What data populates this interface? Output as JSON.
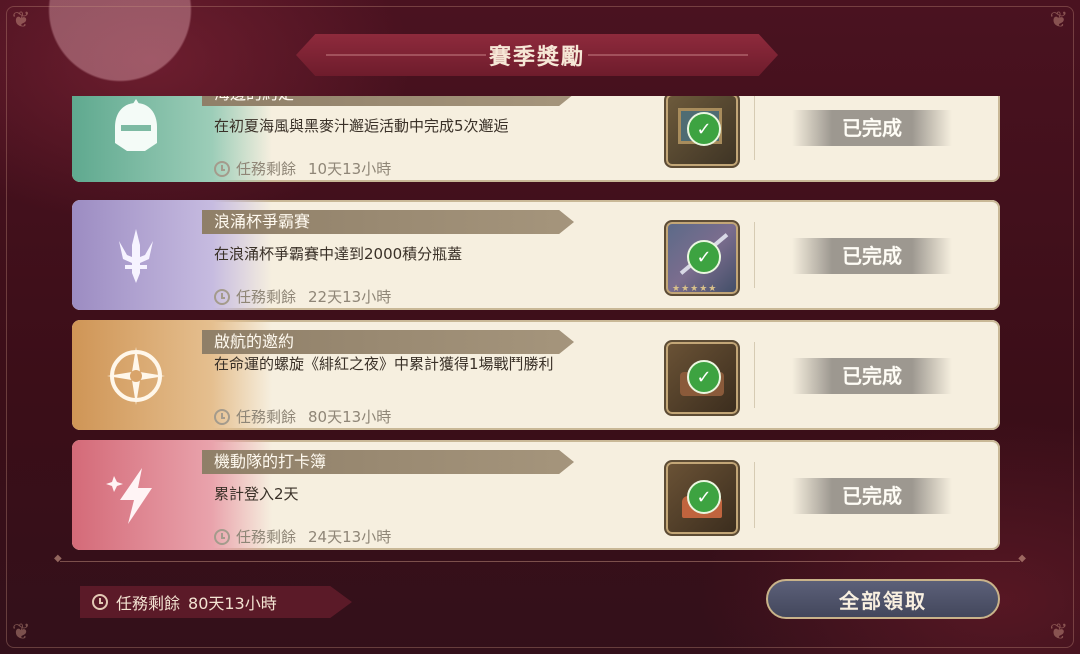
{
  "title": "賽季獎勵",
  "remain_label": "任務剩餘",
  "missions": [
    {
      "name": "海邊的約定",
      "desc": "在初夏海風與黑麥汁邂逅活動中完成5次邂逅",
      "remain": "10天13小時",
      "status": "已完成",
      "theme": "#6fb39a",
      "icon": "knight-helmet-icon",
      "reward_icon": "painting-icon"
    },
    {
      "name": "浪涌杯爭霸賽",
      "desc": "在浪涌杯爭霸賽中達到2000積分瓶蓋",
      "remain": "22天13小時",
      "status": "已完成",
      "theme": "#a797c9",
      "icon": "trident-icon",
      "reward_icon": "scythe-weapon-icon"
    },
    {
      "name": "啟航的邀約",
      "desc": "在命運的螺旋《緋紅之夜》中累計獲得1場戰鬥勝利",
      "remain": "80天13小時",
      "status": "已完成",
      "theme": "#d9a46a",
      "icon": "compass-icon",
      "reward_icon": "furniture-icon"
    },
    {
      "name": "機動隊的打卡簿",
      "desc": "累計登入2天",
      "remain": "24天13小時",
      "status": "已完成",
      "theme": "#d97a86",
      "icon": "lightning-icon",
      "reward_icon": "cake-icon"
    }
  ],
  "footer": {
    "remain_label": "任務剩餘",
    "remain_value": "80天13小時",
    "claim_all": "全部領取"
  },
  "colors": {
    "background": "#3b0e18",
    "card": "#f6efdf",
    "claim_button": "#4f5368",
    "check": "#3da341"
  }
}
